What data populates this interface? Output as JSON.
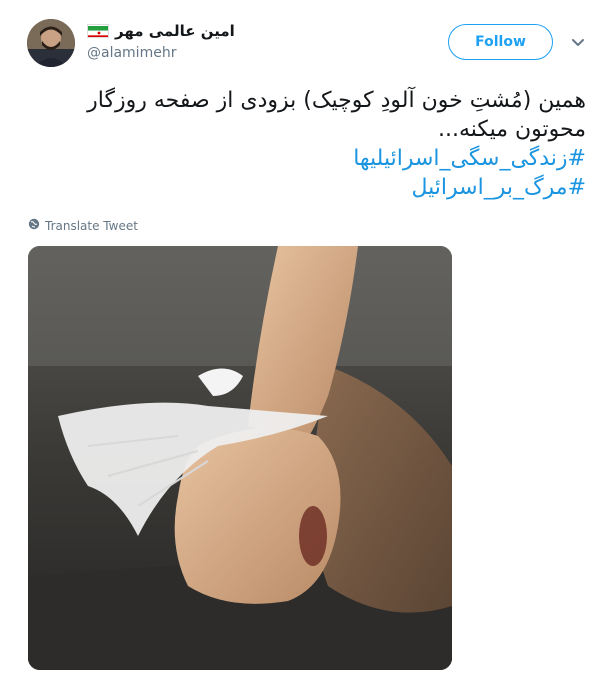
{
  "user": {
    "display_name": "امین عالمی مهر",
    "username": "@alamimehr",
    "flag_icon": "iran-flag-icon"
  },
  "follow_label": "Follow",
  "tweet": {
    "lines": [
      "همین (مُشتِ خون آلودِ کوچیک) بزودی از صفحه روزگار",
      "محوتون میکنه..."
    ],
    "hashtags": [
      "#زندگی_سگی_اسرائیلیها",
      "#مرگ_بر_اسرائیل"
    ]
  },
  "translate_label": "Translate Tweet",
  "colors": {
    "accent": "#1da1f2",
    "hashtag": "#1b95e0",
    "muted": "#657786"
  }
}
